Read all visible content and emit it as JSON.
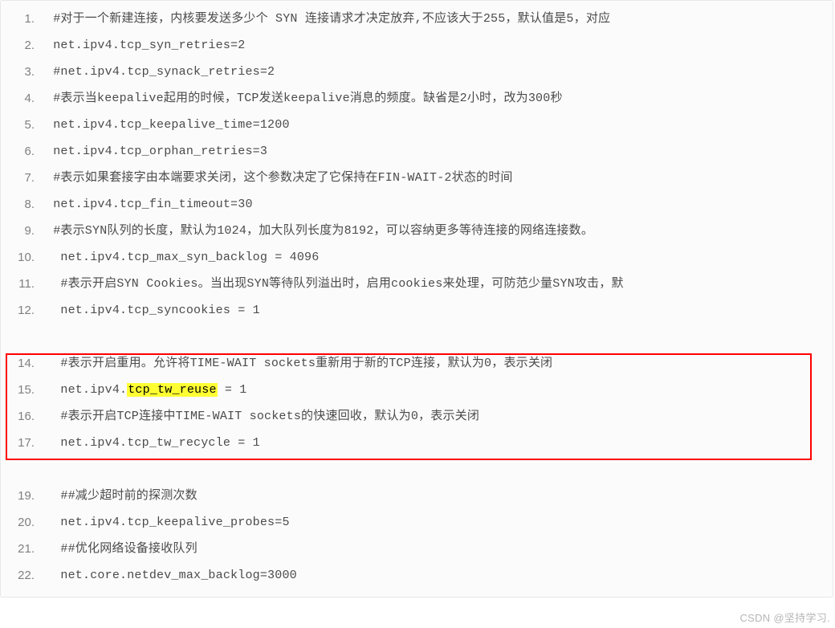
{
  "lines": [
    {
      "num": "1.",
      "tokens": [
        {
          "t": "#对于一个新建连接，内核要发送多少个 SYN 连接请求才决定放弃,不应该大于255，默认值是5，对应"
        }
      ]
    },
    {
      "num": "2.",
      "tokens": [
        {
          "t": "net.ipv4.tcp_syn_retries=2"
        }
      ]
    },
    {
      "num": "3.",
      "tokens": [
        {
          "t": "#net.ipv4.tcp_synack_retries=2"
        }
      ]
    },
    {
      "num": "4.",
      "tokens": [
        {
          "t": "#表示当keepalive起用的时候，TCP发送keepalive消息的频度。缺省是2小时，改为300秒"
        }
      ]
    },
    {
      "num": "5.",
      "tokens": [
        {
          "t": "net.ipv4.tcp_keepalive_time=1200"
        }
      ]
    },
    {
      "num": "6.",
      "tokens": [
        {
          "t": "net.ipv4.tcp_orphan_retries=3"
        }
      ]
    },
    {
      "num": "7.",
      "tokens": [
        {
          "t": "#表示如果套接字由本端要求关闭，这个参数决定了它保持在FIN-WAIT-2状态的时间"
        }
      ]
    },
    {
      "num": "8.",
      "tokens": [
        {
          "t": "net.ipv4.tcp_fin_timeout=30"
        }
      ]
    },
    {
      "num": "9.",
      "tokens": [
        {
          "t": "#表示SYN队列的长度，默认为1024，加大队列长度为8192，可以容纳更多等待连接的网络连接数。"
        }
      ]
    },
    {
      "num": "10.",
      "pad": true,
      "tokens": [
        {
          "t": "net.ipv4.tcp_max_syn_backlog = 4096"
        }
      ]
    },
    {
      "num": "11.",
      "pad": true,
      "tokens": [
        {
          "t": "#表示开启SYN Cookies。当出现SYN等待队列溢出时，启用cookies来处理，可防范少量SYN攻击，默"
        }
      ]
    },
    {
      "num": "12.",
      "pad": true,
      "tokens": [
        {
          "t": "net.ipv4.tcp_syncookies = 1"
        }
      ]
    },
    {
      "num": "",
      "pad": true,
      "tokens": [
        {
          "t": ""
        }
      ]
    },
    {
      "num": "14.",
      "pad": true,
      "tokens": [
        {
          "t": "#表示开启重用。允许将TIME-WAIT sockets重新用于新的TCP连接，默认为0，表示关闭"
        }
      ]
    },
    {
      "num": "15.",
      "pad": true,
      "tokens": [
        {
          "t": "net.ipv4."
        },
        {
          "t": "tcp_tw_reuse",
          "hl": true
        },
        {
          "t": " = 1"
        }
      ]
    },
    {
      "num": "16.",
      "pad": true,
      "tokens": [
        {
          "t": "#表示开启TCP连接中TIME-WAIT sockets的快速回收，默认为0，表示关闭"
        }
      ]
    },
    {
      "num": "17.",
      "pad": true,
      "tokens": [
        {
          "t": "net.ipv4.tcp_tw_recycle = 1"
        }
      ]
    },
    {
      "num": "",
      "pad": true,
      "tokens": [
        {
          "t": ""
        }
      ]
    },
    {
      "num": "19.",
      "pad": true,
      "tokens": [
        {
          "t": "##减少超时前的探测次数"
        }
      ]
    },
    {
      "num": "20.",
      "pad": true,
      "tokens": [
        {
          "t": "net.ipv4.tcp_keepalive_probes=5"
        }
      ]
    },
    {
      "num": "21.",
      "pad": true,
      "tokens": [
        {
          "t": "##优化网络设备接收队列"
        }
      ]
    },
    {
      "num": "22.",
      "pad": true,
      "tokens": [
        {
          "t": "net.core.netdev_max_backlog=3000"
        }
      ]
    }
  ],
  "highlight_color": "#ffff33",
  "redbox_lines": [
    14,
    17
  ],
  "watermark": "CSDN @坚持学习."
}
